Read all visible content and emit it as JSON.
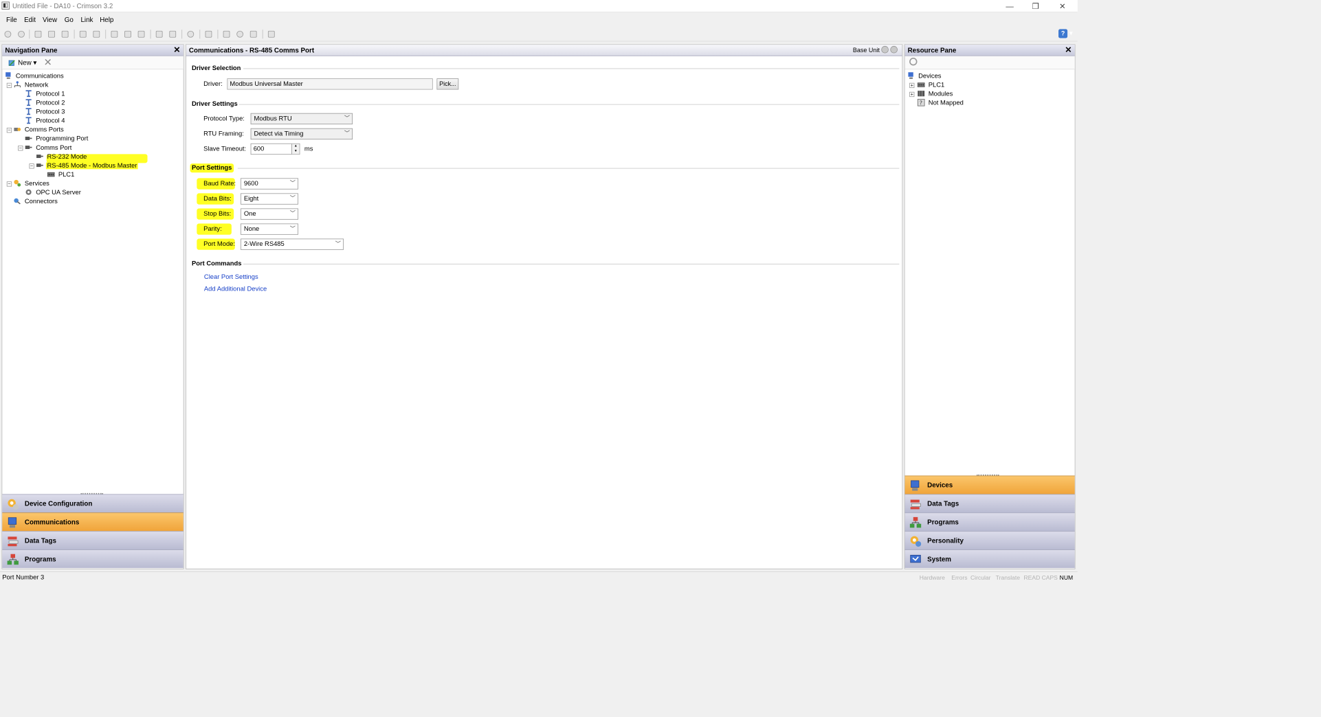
{
  "window": {
    "title": "Untitled File - DA10 - Crimson 3.2",
    "app_icon": "crimson-app-icon",
    "buttons": [
      "minimize",
      "restore",
      "close"
    ]
  },
  "menu": [
    {
      "label": "File"
    },
    {
      "label": "Edit"
    },
    {
      "label": "View"
    },
    {
      "label": "Go"
    },
    {
      "label": "Link"
    },
    {
      "label": "Help"
    }
  ],
  "toolbar": {
    "icons": [
      "back-icon",
      "forward-icon",
      "new-file-icon",
      "open-icon",
      "save-icon",
      "save-all-icon",
      "import-icon",
      "export-icon",
      "cut-icon",
      "copy-icon",
      "paste-icon",
      "find-icon",
      "replace-icon",
      "undo-icon",
      "redo-icon",
      "send-icon",
      "upload-icon",
      "download-icon",
      "link-icon",
      "tool-icon"
    ],
    "help_icon": "help-icon"
  },
  "nav": {
    "title": "Navigation Pane",
    "new_label": "New",
    "tree": [
      {
        "label": "Communications",
        "icon": "communications-icon"
      },
      {
        "label": "Network",
        "icon": "network-icon"
      },
      {
        "label": "Protocol 1",
        "icon": "protocol-icon"
      },
      {
        "label": "Protocol 2",
        "icon": "protocol-icon"
      },
      {
        "label": "Protocol 3",
        "icon": "protocol-icon"
      },
      {
        "label": "Protocol 4",
        "icon": "protocol-icon"
      },
      {
        "label": "Comms Ports",
        "icon": "comms-ports-icon"
      },
      {
        "label": "Programming Port",
        "icon": "port-icon"
      },
      {
        "label": "Comms Port",
        "icon": "port-icon"
      },
      {
        "label": "RS-232 Mode",
        "icon": "port-icon"
      },
      {
        "label": "RS-485 Mode - Modbus Master",
        "icon": "port-icon"
      },
      {
        "label": "PLC1",
        "icon": "device-icon"
      },
      {
        "label": "Services",
        "icon": "services-icon"
      },
      {
        "label": "OPC UA Server",
        "icon": "server-icon"
      },
      {
        "label": "Connectors",
        "icon": "connectors-icon"
      }
    ],
    "bottom_buttons": [
      {
        "label": "Device Configuration",
        "icon": "device-config-icon"
      },
      {
        "label": "Communications",
        "icon": "communications-icon"
      },
      {
        "label": "Data Tags",
        "icon": "data-tags-icon"
      },
      {
        "label": "Programs",
        "icon": "programs-icon"
      }
    ],
    "active_button": "Communications"
  },
  "center": {
    "title": "Communications - RS-485 Comms Port",
    "base_unit": "Base Unit",
    "driver_selection": {
      "title": "Driver Selection",
      "driver_label": "Driver:",
      "driver_value": "Modbus Universal Master",
      "pick_label": "Pick..."
    },
    "driver_settings": {
      "title": "Driver Settings",
      "protocol_type_label": "Protocol Type:",
      "protocol_type_value": "Modbus RTU",
      "rtu_framing_label": "RTU Framing:",
      "rtu_framing_value": "Detect via Timing",
      "slave_timeout_label": "Slave Timeout:",
      "slave_timeout_value": "600",
      "slave_timeout_unit": "ms"
    },
    "port_settings": {
      "title": "Port Settings",
      "baud_rate_label": "Baud Rate:",
      "baud_rate_value": "9600",
      "data_bits_label": "Data Bits:",
      "data_bits_value": "Eight",
      "stop_bits_label": "Stop Bits:",
      "stop_bits_value": "One",
      "parity_label": "Parity:",
      "parity_value": "None",
      "port_mode_label": "Port Mode:",
      "port_mode_value": "2-Wire RS485"
    },
    "port_commands": {
      "title": "Port Commands",
      "clear_label": "Clear Port Settings",
      "add_label": "Add Additional Device"
    }
  },
  "resource": {
    "title": "Resource Pane",
    "tree": [
      {
        "label": "Devices",
        "icon": "devices-icon"
      },
      {
        "label": "PLC1",
        "icon": "plc-icon"
      },
      {
        "label": "Modules",
        "icon": "modules-icon"
      },
      {
        "label": "Not Mapped",
        "icon": "not-mapped-icon"
      }
    ],
    "bottom_buttons": [
      {
        "label": "Devices",
        "icon": "devices-icon"
      },
      {
        "label": "Data Tags",
        "icon": "data-tags-icon"
      },
      {
        "label": "Programs",
        "icon": "programs-icon"
      },
      {
        "label": "Personality",
        "icon": "personality-icon"
      },
      {
        "label": "System",
        "icon": "system-icon"
      }
    ],
    "active_button": "Devices"
  },
  "status": {
    "text": "Port Number 3",
    "indicators": [
      "Hardware",
      "Errors",
      "Circular",
      "Translate",
      "READ",
      "CAPS",
      "NUM"
    ],
    "active_indicator": "NUM"
  },
  "colors": {
    "highlight": "#ffff24",
    "active_tab": "#f5b04c",
    "link": "#1740c8"
  }
}
